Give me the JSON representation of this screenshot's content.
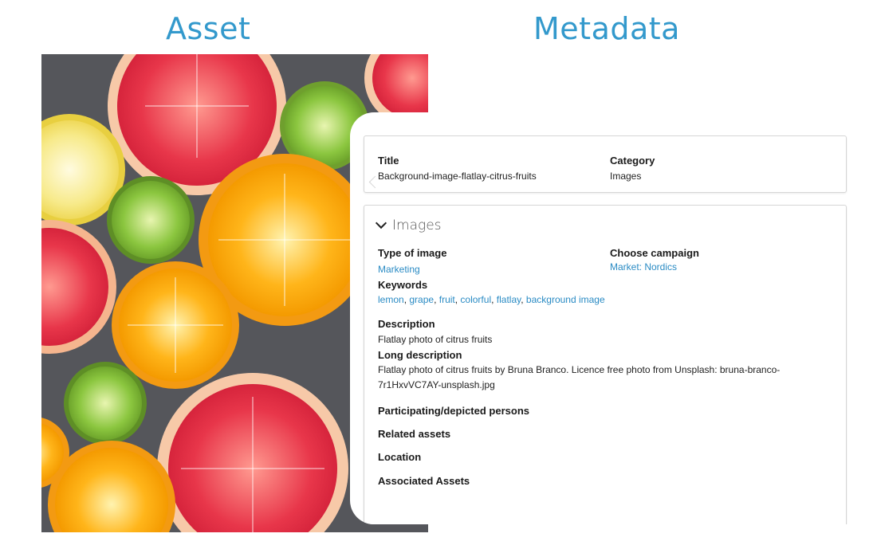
{
  "headings": {
    "asset": "Asset",
    "metadata": "Metadata"
  },
  "photo": {
    "subject": "flatlay-citrus-fruits"
  },
  "title_card": {
    "title_label": "Title",
    "title_value": "Background-image-flatlay-citrus-fruits",
    "category_label": "Category",
    "category_value": "Images"
  },
  "images_section": {
    "header": "Images",
    "type_label": "Type of image",
    "type_value": "Marketing",
    "campaign_label": "Choose campaign",
    "campaign_value": "Market: Nordics",
    "keywords_label": "Keywords",
    "keywords": [
      "lemon",
      "grape",
      "fruit",
      "colorful",
      "flatlay",
      "background image"
    ],
    "description_label": "Description",
    "description_value": "Flatlay photo of citrus fruits",
    "long_description_label": "Long description",
    "long_description_value": "Flatlay photo of citrus fruits by Bruna Branco. Licence free photo from Unsplash: bruna-branco-7r1HxvVC7AY-unsplash.jpg",
    "participating_label": "Participating/depicted persons",
    "related_label": "Related assets",
    "location_label": "Location",
    "associated_label": "Associated Assets"
  },
  "colors": {
    "accent": "#3399cc",
    "link": "#2a8bc4"
  }
}
